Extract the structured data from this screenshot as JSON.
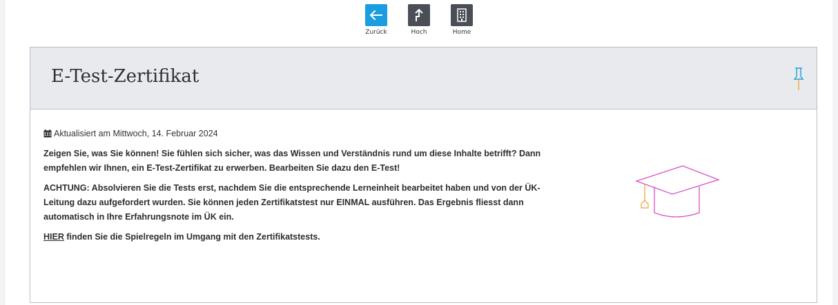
{
  "nav": {
    "back_label": "Zurück",
    "up_label": "Hoch",
    "home_label": "Home"
  },
  "card": {
    "title": "E-Test-Zertifikat",
    "updated": "Aktualisiert am Mittwoch, 14. Februar 2024",
    "para1": "Zeigen Sie, was Sie können! Sie fühlen sich sicher, was das Wissen und Verständnis rund um diese Inhalte betrifft? Dann empfehlen wir Ihnen, ein E-Test-Zertifikat zu erwerben. Bearbeiten Sie dazu den E-Test!",
    "para2": "ACHTUNG: Absolvieren Sie die Tests erst, nachdem Sie die entsprechende Lerneinheit bearbeitet haben und von der ÜK-Leitung dazu aufgefordert wurden. Sie können jeden Zertifikatstest nur EINMAL ausführen. Das Ergebnis fliesst dann automatisch in Ihre Erfahrungsnote im ÜK ein.",
    "link_text": "HIER",
    "para3_rest": " finden Sie die Spielregeln im Umgang mit den Zertifikatstests."
  },
  "icons": {
    "back": "arrow-left-icon",
    "up": "arrow-up-icon",
    "home": "building-icon",
    "pin": "pin-icon",
    "calendar": "calendar-icon",
    "cap": "graduation-cap-icon"
  },
  "colors": {
    "back_button": "#1a9ee0",
    "nav_button": "#4a4e57",
    "cap_pink": "#d94fc4",
    "cap_orange": "#f0a43a",
    "pin_blue": "#1a9ee0"
  }
}
